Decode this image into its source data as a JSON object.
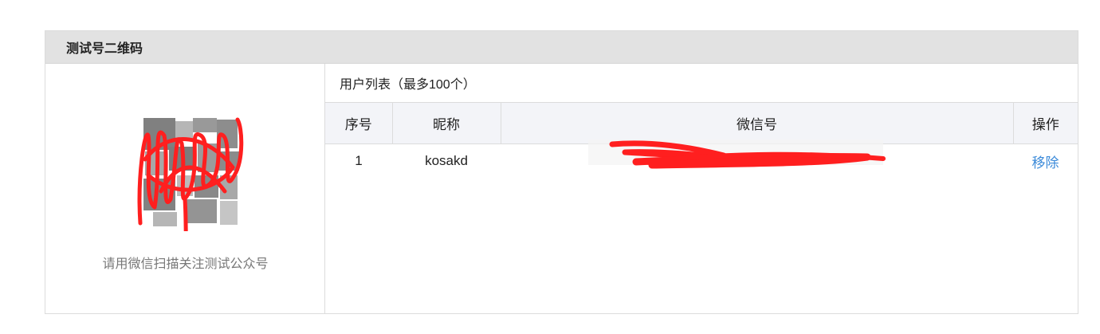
{
  "panel": {
    "title": "测试号二维码"
  },
  "qr": {
    "caption": "请用微信扫描关注测试公众号"
  },
  "user_list": {
    "title": "用户列表（最多100个）",
    "columns": [
      "序号",
      "昵称",
      "微信号",
      "操作"
    ],
    "rows": [
      {
        "index": "1",
        "nickname": "kosakd",
        "wechat_id": "",
        "action": "移除"
      }
    ]
  },
  "colors": {
    "header_bg": "#e2e2e2",
    "table_header_bg": "#f3f4f8",
    "link": "#3b8ad9",
    "scribble": "#ff1f1f"
  }
}
